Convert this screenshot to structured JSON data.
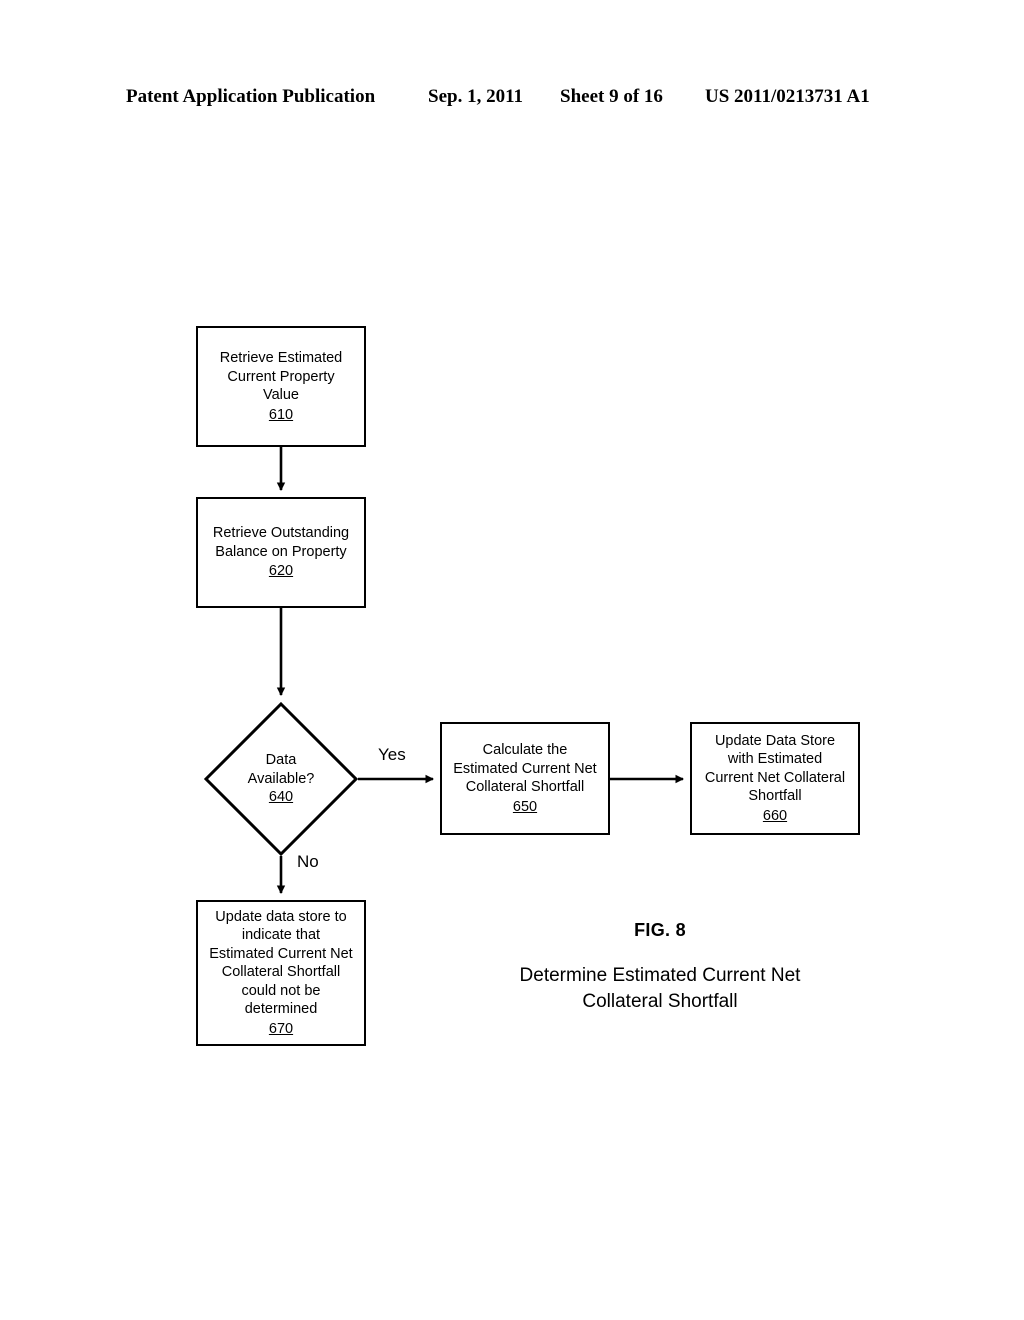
{
  "header": {
    "publication": "Patent Application Publication",
    "date": "Sep. 1, 2011",
    "sheet": "Sheet 9 of 16",
    "patent_number": "US 2011/0213731 A1"
  },
  "figure": {
    "number": "FIG. 8",
    "caption_line1": "Determine Estimated Current Net",
    "caption_line2": "Collateral Shortfall",
    "nodes": [
      {
        "id": "610",
        "type": "process",
        "line1": "Retrieve Estimated",
        "line2": "Current Property",
        "line3": "Value",
        "ref": "610"
      },
      {
        "id": "620",
        "type": "process",
        "line1": "Retrieve Outstanding",
        "line2": "Balance on Property",
        "ref": "620"
      },
      {
        "id": "640",
        "type": "decision",
        "line1": "Data",
        "line2": "Available?",
        "ref": "640"
      },
      {
        "id": "650",
        "type": "process",
        "line1": "Calculate the",
        "line2": "Estimated Current Net",
        "line3": "Collateral Shortfall",
        "ref": "650"
      },
      {
        "id": "660",
        "type": "process",
        "line1": "Update Data Store",
        "line2": "with Estimated",
        "line3": "Current Net Collateral",
        "line4": "Shortfall",
        "ref": "660"
      },
      {
        "id": "670",
        "type": "process",
        "line1": "Update data store to",
        "line2": "indicate that",
        "line3": "Estimated Current Net",
        "line4": "Collateral Shortfall",
        "line5": "could not be",
        "line6": "determined",
        "ref": "670"
      }
    ],
    "edge_labels": {
      "yes": "Yes",
      "no": "No"
    }
  },
  "colors": {
    "ink": "#000000",
    "paper": "#ffffff"
  }
}
